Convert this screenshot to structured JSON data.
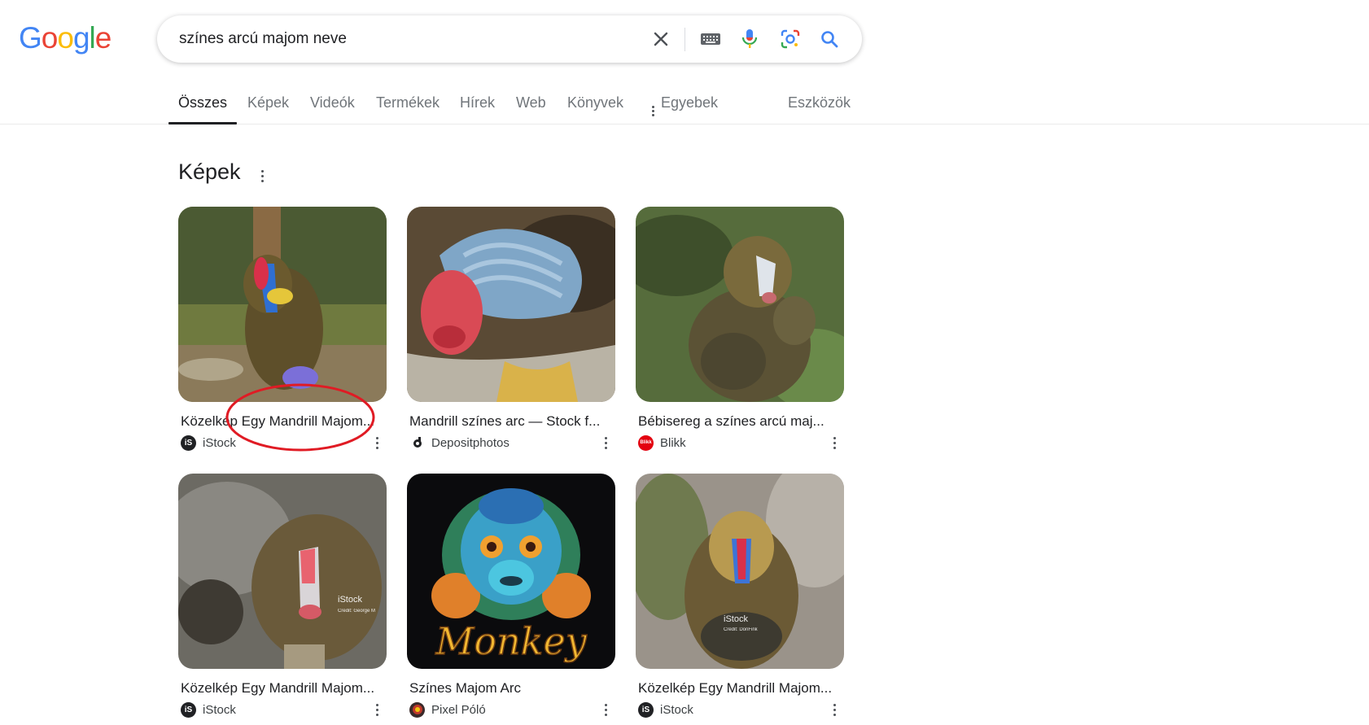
{
  "logo": {
    "letters": [
      "G",
      "o",
      "o",
      "g",
      "l",
      "e"
    ],
    "colors": [
      "#4285f4",
      "#ea4335",
      "#fbbc05",
      "#4285f4",
      "#34a853",
      "#ea4335"
    ]
  },
  "search": {
    "query": "színes arcú majom neve"
  },
  "tabs": [
    {
      "label": "Összes",
      "active": true
    },
    {
      "label": "Képek"
    },
    {
      "label": "Videók"
    },
    {
      "label": "Termékek"
    },
    {
      "label": "Hírek"
    },
    {
      "label": "Web"
    },
    {
      "label": "Könyvek"
    },
    {
      "label": "Egyebek"
    },
    {
      "label": "Eszközök"
    }
  ],
  "images_section": {
    "title": "Képek",
    "results": [
      {
        "caption": "Közelkép Egy Mandrill Majom...",
        "source": "iStock",
        "source_icon": "istock-logo",
        "source_color": "#202124"
      },
      {
        "caption": "Mandrill színes arc — Stock f...",
        "source": "Depositphotos",
        "source_icon": "depositphotos-logo",
        "source_color": "#202124"
      },
      {
        "caption": "Bébisereg a színes arcú maj...",
        "source": "Blikk",
        "source_icon": "blikk-logo",
        "source_color": "#e3000f",
        "source_logo_text": "Blikk"
      },
      {
        "caption": "Közelkép Egy Mandrill Majom...",
        "source": "iStock",
        "source_icon": "istock-logo",
        "source_color": "#202124",
        "watermark": "iStock",
        "watermark_credit": "Credit: George M"
      },
      {
        "caption": "Színes Majom Arc",
        "source": "Pixel Póló",
        "source_icon": "pixel-polo-logo",
        "source_color": "#c0392b",
        "art_text": "Monkey"
      },
      {
        "caption": "Közelkép Egy Mandrill Majom...",
        "source": "iStock",
        "source_icon": "istock-logo",
        "source_color": "#202124",
        "watermark": "iStock",
        "watermark_credit": "Credit: DonFink"
      }
    ]
  },
  "annotation": {
    "type": "red-ellipse",
    "color": "#e01b24"
  }
}
